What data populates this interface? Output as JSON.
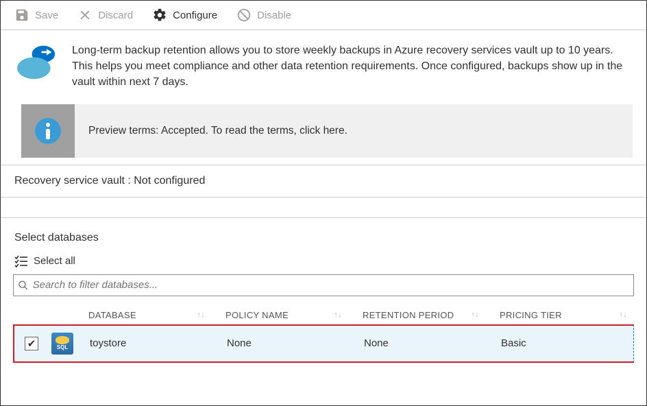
{
  "toolbar": {
    "save": "Save",
    "discard": "Discard",
    "configure": "Configure",
    "disable": "Disable"
  },
  "description": "Long-term backup retention allows you to store weekly backups in Azure recovery services vault up to 10 years. This helps you meet compliance and other data retention requirements. Once configured, backups show up in the vault within next 7 days.",
  "banner": {
    "text": "Preview terms: Accepted. To read the terms, click here."
  },
  "vault": {
    "label": "Recovery service vault : ",
    "value": "Not configured"
  },
  "section": {
    "select_db": "Select databases",
    "select_all": "Select all"
  },
  "search": {
    "placeholder": "Search to filter databases..."
  },
  "columns": {
    "database": "DATABASE",
    "policy": "POLICY NAME",
    "retention": "RETENTION PERIOD",
    "tier": "PRICING TIER"
  },
  "rows": [
    {
      "checked": true,
      "name": "toystore",
      "policy": "None",
      "retention": "None",
      "tier": "Basic"
    }
  ]
}
